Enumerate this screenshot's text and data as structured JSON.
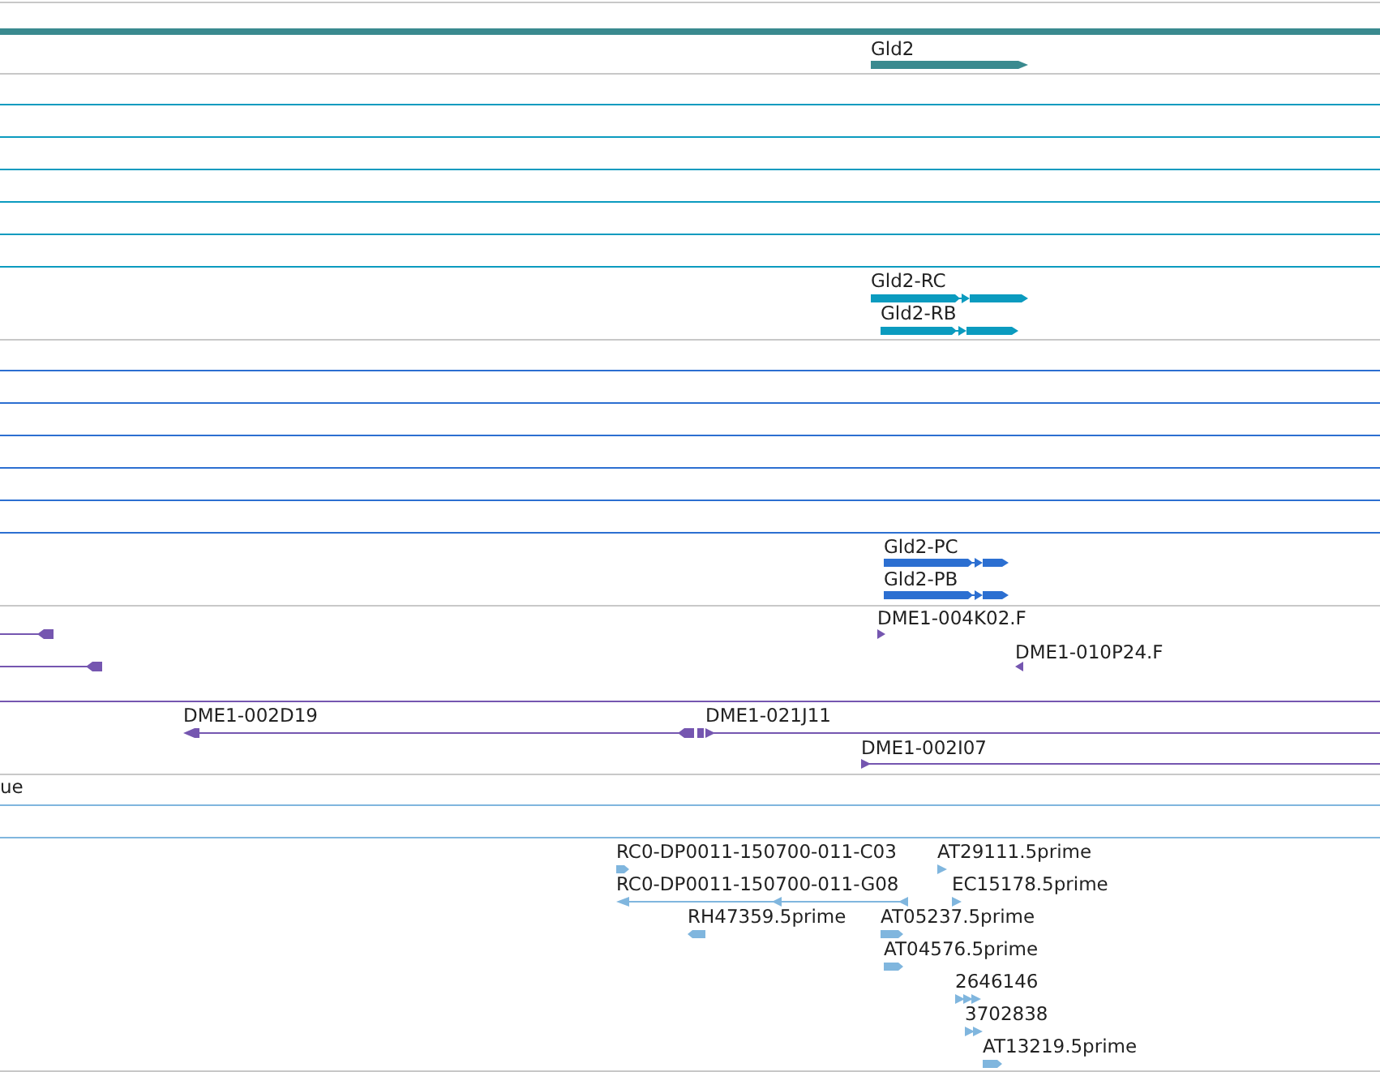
{
  "tracks": [
    {
      "kind": "gene",
      "color": "#3a8a8f",
      "features": [
        {
          "label": "Gld2"
        }
      ]
    },
    {
      "kind": "transcript",
      "color": "#0b9bbf",
      "features": [
        {
          "label": "Gld2-RC"
        },
        {
          "label": "Gld2-RB"
        }
      ]
    },
    {
      "kind": "protein",
      "color": "#2c6fd1",
      "features": [
        {
          "label": "Gld2-PC"
        },
        {
          "label": "Gld2-PB"
        }
      ]
    },
    {
      "kind": "clone",
      "color": "#7556b0",
      "features": [
        {
          "label": "DME1-004K02.F"
        },
        {
          "label": "DME1-010P24.F"
        },
        {
          "label": "DME1-002D19"
        },
        {
          "label": "DME1-021J11"
        },
        {
          "label": "DME1-002I07"
        }
      ]
    },
    {
      "kind": "misc",
      "features": [
        {
          "label": "ue"
        }
      ]
    },
    {
      "kind": "est",
      "color": "#80b6de",
      "features": [
        {
          "label": "RC0-DP0011-150700-011-C03"
        },
        {
          "label": "AT29111.5prime"
        },
        {
          "label": "RC0-DP0011-150700-011-G08"
        },
        {
          "label": "EC15178.5prime"
        },
        {
          "label": "RH47359.5prime"
        },
        {
          "label": "AT05237.5prime"
        },
        {
          "label": "AT04576.5prime"
        },
        {
          "label": "2646146"
        },
        {
          "label": "3702838"
        },
        {
          "label": "AT13219.5prime"
        }
      ]
    }
  ]
}
